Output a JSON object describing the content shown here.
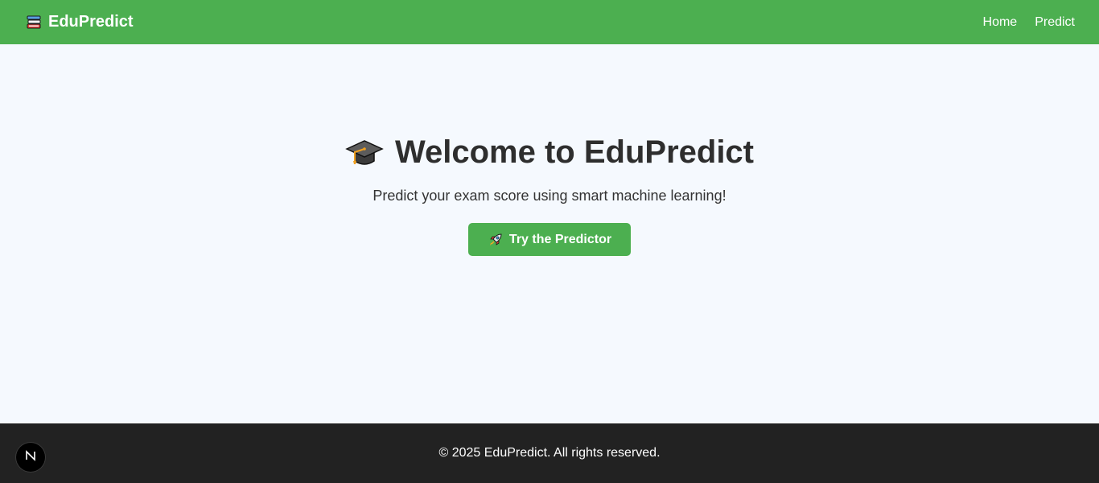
{
  "navbar": {
    "brand_icon": "books-icon",
    "brand_name": "EduPredict",
    "links": [
      {
        "label": "Home"
      },
      {
        "label": "Predict"
      }
    ],
    "background_color": "#4caf50"
  },
  "hero": {
    "title_icon": "graduation-cap-icon",
    "title": "Welcome to EduPredict",
    "subtitle": "Predict your exam score using smart machine learning!",
    "cta": {
      "icon": "rocket-icon",
      "label": "Try the Predictor"
    }
  },
  "footer": {
    "text": "© 2025 EduPredict. All rights reserved.",
    "background_color": "#222222"
  },
  "dev_badge": {
    "icon": "nextjs-logo-icon"
  }
}
